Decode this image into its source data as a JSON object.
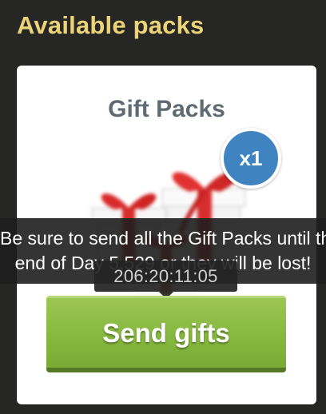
{
  "heading": "Available packs",
  "pack": {
    "title": "Gift Packs",
    "count_badge": "x1",
    "image_icon": "gift-boxes-icon"
  },
  "warning": {
    "line1": "Be sure to send all the Gift Packs until the",
    "line2": "end of Day 5,529 or they will be lost!"
  },
  "timer": "206:20:11:05",
  "send_button_label": "Send gifts",
  "colors": {
    "background": "#262624",
    "heading": "#ecd377",
    "badge": "#3f84c0",
    "button": "#86b83f",
    "card_title": "#5f6a73"
  }
}
